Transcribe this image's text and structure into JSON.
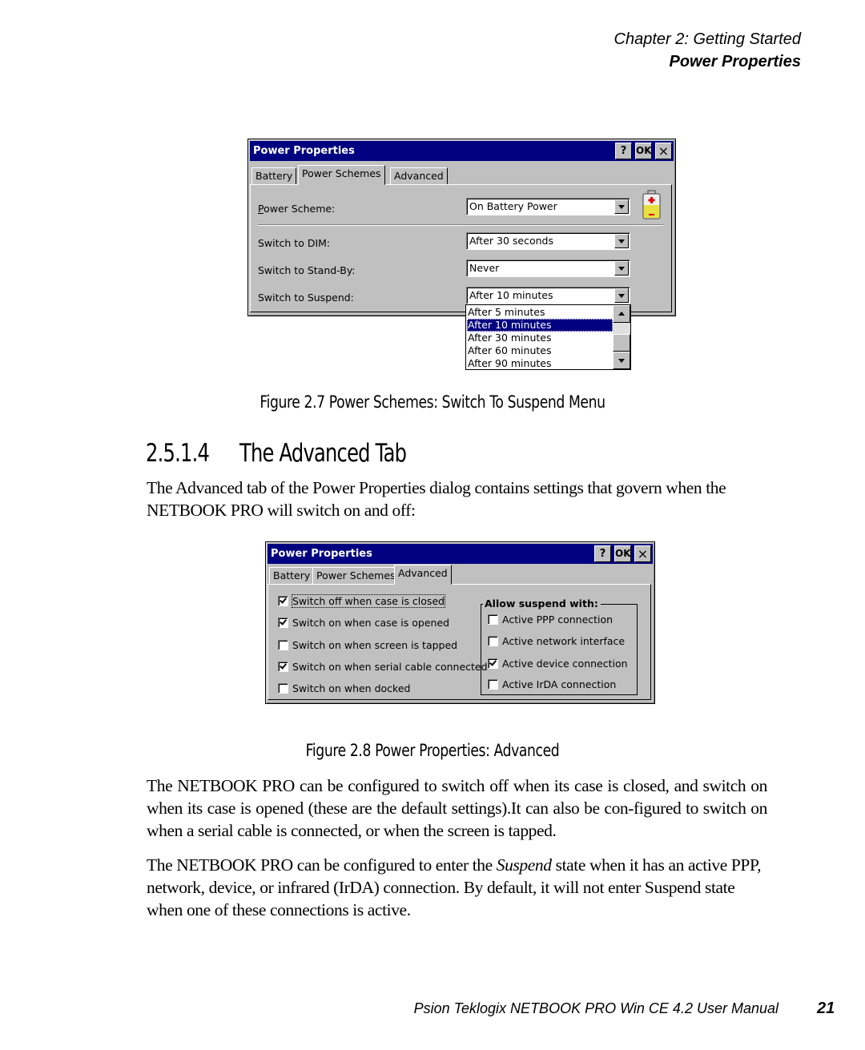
{
  "header": {
    "chapter": "Chapter 2:  Getting Started",
    "section": "Power Properties"
  },
  "figure1": {
    "dialog_title": "Power Properties",
    "title_buttons": {
      "help": "?",
      "ok": "OK",
      "close": "×"
    },
    "tabs": [
      {
        "label": "Battery",
        "active": false
      },
      {
        "label": "Power Schemes",
        "active": true
      },
      {
        "label": "Advanced",
        "active": false
      }
    ],
    "power_scheme": {
      "label": "Power Scheme:",
      "value": "On Battery Power",
      "icon": "battery-icon"
    },
    "dim": {
      "label": "Switch to DIM:",
      "value": "After 30 seconds"
    },
    "standby": {
      "label": "Switch to Stand-By:",
      "value": "Never"
    },
    "suspend": {
      "label": "Switch to Suspend:",
      "value": "After 10 minutes",
      "options": [
        "After 5 minutes",
        "After 10 minutes",
        "After 30 minutes",
        "After 60 minutes",
        "After 90 minutes"
      ],
      "selected_index": 1
    },
    "caption": "Figure 2.7 Power Schemes: Switch To Suspend Menu"
  },
  "section_heading": {
    "number": "2.5.1.4",
    "title": "The Advanced Tab"
  },
  "intro_paragraph": "The Advanced tab of the Power Properties dialog contains settings that govern when the NETBOOK PRO will switch on and off:",
  "figure2": {
    "dialog_title": "Power Properties",
    "title_buttons": {
      "help": "?",
      "ok": "OK",
      "close": "×"
    },
    "tabs": [
      {
        "label": "Battery",
        "active": false
      },
      {
        "label": "Power Schemes",
        "active": false
      },
      {
        "label": "Advanced",
        "active": true
      }
    ],
    "switch_options": [
      {
        "label": "Switch off when case is closed",
        "checked": true
      },
      {
        "label": "Switch on when case is opened",
        "checked": true
      },
      {
        "label": "Switch on when screen is tapped",
        "checked": false
      },
      {
        "label": "Switch on when serial cable connected",
        "checked": true
      },
      {
        "label": "Switch on when docked",
        "checked": false
      }
    ],
    "suspend_group": {
      "title": "Allow suspend with:",
      "options": [
        {
          "label": "Active PPP connection",
          "checked": false
        },
        {
          "label": "Active network interface",
          "checked": false
        },
        {
          "label": "Active device connection",
          "checked": true
        },
        {
          "label": "Active IrDA connection",
          "checked": false
        }
      ]
    },
    "caption": "Figure 2.8 Power Properties: Advanced"
  },
  "paragraph2": {
    "text": "The NETBOOK PRO can be configured to switch off when its case is closed, and switch on when its case is opened (these are the default settings).It can also be con-figured to switch on when a serial cable is connected, or when the screen is tapped."
  },
  "paragraph3": {
    "before": "The NETBOOK PRO can be configured to enter the ",
    "emphasis": "Suspend",
    "after": " state when it has an active PPP, network, device, or infrared (IrDA) connection. By default, it will not enter Suspend state when one of these connections is active."
  },
  "footer": {
    "manual_title": "Psion Teklogix NETBOOK PRO Win CE 4.2 User Manual",
    "page_number": "21"
  }
}
